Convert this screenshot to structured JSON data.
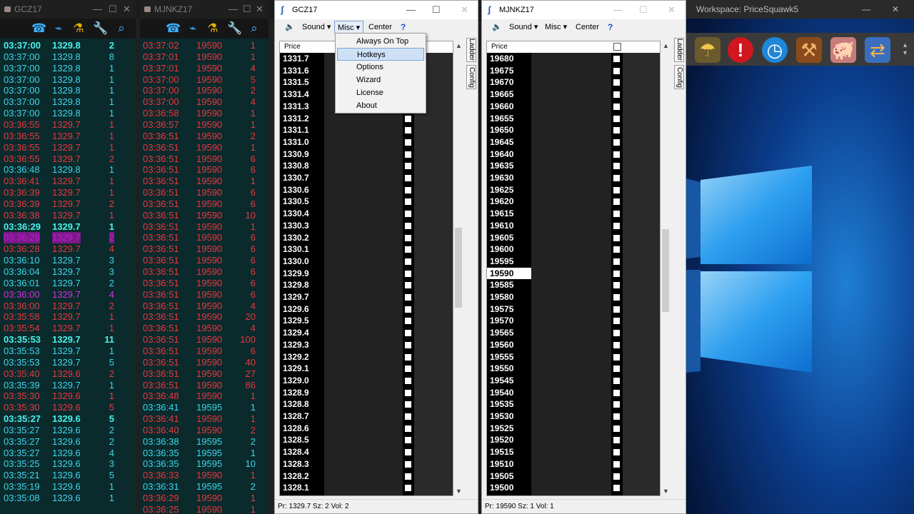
{
  "ts_left": {
    "title": "GCZ17",
    "rows": [
      [
        "03:37:00",
        "1329.8",
        "2",
        "bold"
      ],
      [
        "03:37:00",
        "1329.8",
        "8",
        "cyan"
      ],
      [
        "03:37:00",
        "1329.8",
        "1",
        "cyan"
      ],
      [
        "03:37:00",
        "1329.8",
        "1",
        "cyan"
      ],
      [
        "03:37:00",
        "1329.8",
        "1",
        "cyan"
      ],
      [
        "03:37:00",
        "1329.8",
        "1",
        "cyan"
      ],
      [
        "03:37:00",
        "1329.8",
        "1",
        "cyan"
      ],
      [
        "03:36:55",
        "1329.7",
        "1",
        "red"
      ],
      [
        "03:36:55",
        "1329.7",
        "1",
        "red"
      ],
      [
        "03:36:55",
        "1329.7",
        "1",
        "red"
      ],
      [
        "03:36:55",
        "1329.7",
        "2",
        "red"
      ],
      [
        "03:36:48",
        "1329.8",
        "1",
        "cyan"
      ],
      [
        "03:36:41",
        "1329.7",
        "1",
        "red"
      ],
      [
        "03:36:39",
        "1329.7",
        "1",
        "red"
      ],
      [
        "03:36:39",
        "1329.7",
        "2",
        "red"
      ],
      [
        "03:36:38",
        "1329.7",
        "1",
        "red"
      ],
      [
        "03:36:29",
        "1329.7",
        "1",
        "bold"
      ],
      [
        "03:36:28",
        "1329.7",
        "2",
        "mag"
      ],
      [
        "03:36:28",
        "1329.7",
        "4",
        "red"
      ],
      [
        "03:36:10",
        "1329.7",
        "3",
        "cyan"
      ],
      [
        "03:36:04",
        "1329.7",
        "3",
        "cyan"
      ],
      [
        "03:36:01",
        "1329.7",
        "2",
        "cyan"
      ],
      [
        "03:36:00",
        "1329.7",
        "4",
        "mag2"
      ],
      [
        "03:36:00",
        "1329.7",
        "2",
        "red"
      ],
      [
        "03:35:58",
        "1329.7",
        "1",
        "red"
      ],
      [
        "03:35:54",
        "1329.7",
        "1",
        "red"
      ],
      [
        "03:35:53",
        "1329.7",
        "11",
        "bold"
      ],
      [
        "03:35:53",
        "1329.7",
        "1",
        "cyan"
      ],
      [
        "03:35:53",
        "1329.7",
        "5",
        "cyan"
      ],
      [
        "03:35:40",
        "1329.6",
        "2",
        "red"
      ],
      [
        "03:35:39",
        "1329.7",
        "1",
        "cyan"
      ],
      [
        "03:35:30",
        "1329.6",
        "1",
        "red"
      ],
      [
        "03:35:30",
        "1329.6",
        "5",
        "red"
      ],
      [
        "03:35:27",
        "1329.6",
        "5",
        "bold"
      ],
      [
        "03:35:27",
        "1329.6",
        "2",
        "cyan"
      ],
      [
        "03:35:27",
        "1329.6",
        "2",
        "cyan"
      ],
      [
        "03:35:27",
        "1329.6",
        "4",
        "cyan"
      ],
      [
        "03:35:25",
        "1329.6",
        "3",
        "cyan"
      ],
      [
        "03:35:21",
        "1329.6",
        "5",
        "cyan"
      ],
      [
        "03:35:19",
        "1329.6",
        "1",
        "cyan"
      ],
      [
        "03:35:08",
        "1329.6",
        "1",
        "cyan"
      ]
    ]
  },
  "ts_right": {
    "title": "MJNKZ17",
    "rows": [
      [
        "03:37:02",
        "19590",
        "1",
        "red"
      ],
      [
        "03:37:01",
        "19590",
        "1",
        "red"
      ],
      [
        "03:37:01",
        "19590",
        "4",
        "red"
      ],
      [
        "03:37:00",
        "19590",
        "5",
        "red"
      ],
      [
        "03:37:00",
        "19590",
        "2",
        "red"
      ],
      [
        "03:37:00",
        "19590",
        "4",
        "red"
      ],
      [
        "03:36:58",
        "19590",
        "1",
        "red"
      ],
      [
        "03:36:57",
        "19590",
        "1",
        "red"
      ],
      [
        "03:36:51",
        "19590",
        "2",
        "red"
      ],
      [
        "03:36:51",
        "19590",
        "1",
        "red"
      ],
      [
        "03:36:51",
        "19590",
        "6",
        "red"
      ],
      [
        "03:36:51",
        "19590",
        "6",
        "red"
      ],
      [
        "03:36:51",
        "19590",
        "1",
        "red"
      ],
      [
        "03:36:51",
        "19590",
        "6",
        "red"
      ],
      [
        "03:36:51",
        "19590",
        "6",
        "red"
      ],
      [
        "03:36:51",
        "19590",
        "10",
        "red"
      ],
      [
        "03:36:51",
        "19590",
        "1",
        "red"
      ],
      [
        "03:36:51",
        "19590",
        "6",
        "red"
      ],
      [
        "03:36:51",
        "19590",
        "6",
        "red"
      ],
      [
        "03:36:51",
        "19590",
        "6",
        "red"
      ],
      [
        "03:36:51",
        "19590",
        "6",
        "red"
      ],
      [
        "03:36:51",
        "19590",
        "6",
        "red"
      ],
      [
        "03:36:51",
        "19590",
        "6",
        "red"
      ],
      [
        "03:36:51",
        "19590",
        "4",
        "red"
      ],
      [
        "03:36:51",
        "19590",
        "20",
        "red"
      ],
      [
        "03:36:51",
        "19590",
        "4",
        "red"
      ],
      [
        "03:36:51",
        "19590",
        "100",
        "red"
      ],
      [
        "03:36:51",
        "19590",
        "6",
        "red"
      ],
      [
        "03:36:51",
        "19590",
        "40",
        "red"
      ],
      [
        "03:36:51",
        "19590",
        "27",
        "red"
      ],
      [
        "03:36:51",
        "19590",
        "86",
        "red"
      ],
      [
        "03:36:48",
        "19590",
        "1",
        "red"
      ],
      [
        "03:36:41",
        "19595",
        "1",
        "cyan"
      ],
      [
        "03:36:41",
        "19590",
        "1",
        "red"
      ],
      [
        "03:36:40",
        "19590",
        "2",
        "red"
      ],
      [
        "03:36:38",
        "19595",
        "2",
        "cyan"
      ],
      [
        "03:36:35",
        "19595",
        "1",
        "cyan"
      ],
      [
        "03:36:35",
        "19595",
        "10",
        "cyan"
      ],
      [
        "03:36:33",
        "19590",
        "1",
        "red"
      ],
      [
        "03:36:31",
        "19595",
        "2",
        "cyan"
      ],
      [
        "03:36:29",
        "19590",
        "1",
        "red"
      ],
      [
        "03:36:25",
        "19590",
        "1",
        "red"
      ]
    ]
  },
  "gc_window": {
    "title": "GCZ17",
    "sound": "Sound",
    "misc": "Misc",
    "center": "Center",
    "help": "?",
    "price_header": "Price",
    "prices": [
      "1331.7",
      "1331.6",
      "1331.5",
      "1331.4",
      "1331.3",
      "1331.2",
      "1331.1",
      "1331.0",
      "1330.9",
      "1330.8",
      "1330.7",
      "1330.6",
      "1330.5",
      "1330.4",
      "1330.3",
      "1330.2",
      "1330.1",
      "1330.0",
      "1329.9",
      "1329.8",
      "1329.7",
      "1329.6",
      "1329.5",
      "1329.4",
      "1329.3",
      "1329.2",
      "1329.1",
      "1329.0",
      "1328.9",
      "1328.8",
      "1328.7",
      "1328.6",
      "1328.5",
      "1328.4",
      "1328.3",
      "1328.2",
      "1328.1"
    ],
    "tab_ladder": "Ladder",
    "tab_config": "Config",
    "status": "Pr: 1329.7 Sz: 2 Vol: 2"
  },
  "menu": {
    "items": [
      "Always On Top",
      "Hotkeys",
      "Options",
      "Wizard",
      "License",
      "About"
    ]
  },
  "mj_window": {
    "title": "MJNKZ17",
    "sound": "Sound",
    "misc": "Misc",
    "center": "Center",
    "help": "?",
    "price_header": "Price",
    "prices": [
      "19680",
      "19675",
      "19670",
      "19665",
      "19660",
      "19655",
      "19650",
      "19645",
      "19640",
      "19635",
      "19630",
      "19625",
      "19620",
      "19615",
      "19610",
      "19605",
      "19600",
      "19595",
      "19590",
      "19585",
      "19580",
      "19575",
      "19570",
      "19565",
      "19560",
      "19555",
      "19550",
      "19545",
      "19540",
      "19535",
      "19530",
      "19525",
      "19520",
      "19515",
      "19510",
      "19505",
      "19500"
    ],
    "highlight": "19590",
    "tab_ladder": "Ladder",
    "tab_config": "Config",
    "status": "Pr: 19590 Sz: 1 Vol: 1"
  },
  "workspace": {
    "title": "Workspace: PriceSquawk5"
  }
}
